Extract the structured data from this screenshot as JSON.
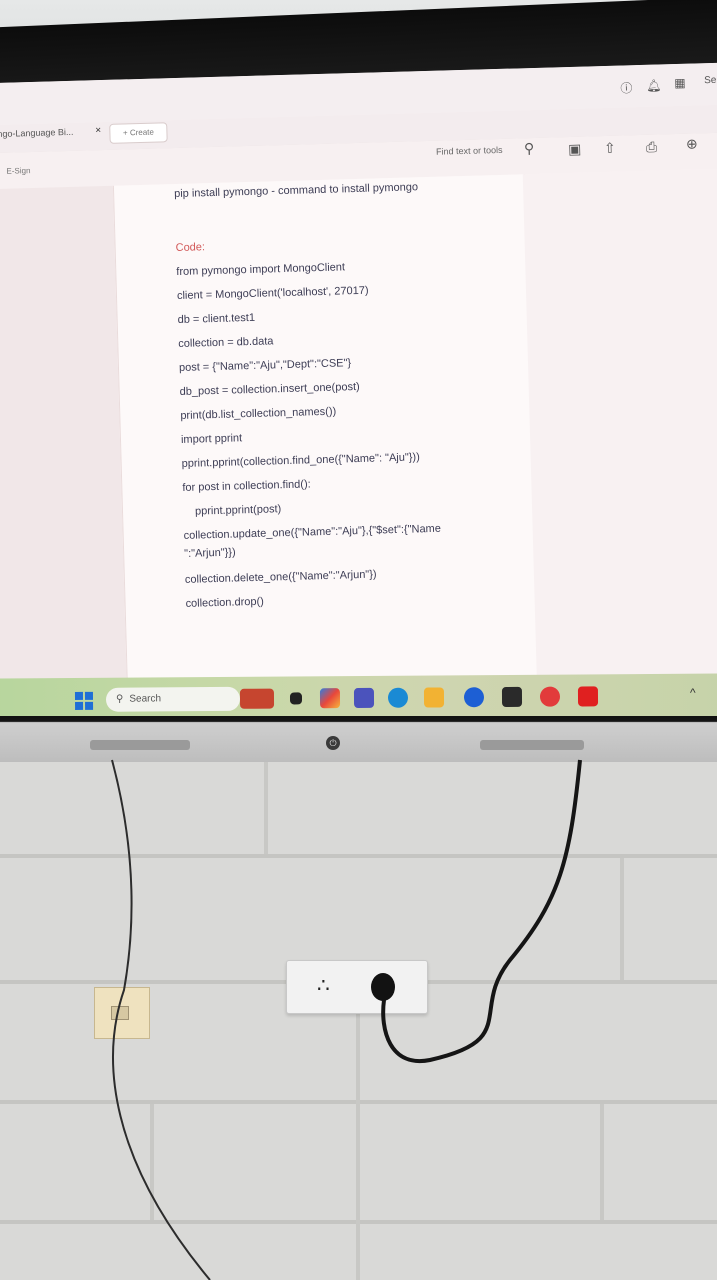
{
  "screen": {
    "tab_label": "ngo-Language Bi...",
    "tab_close": "×",
    "create_button": "+ Create",
    "esign_label": "E-Sign",
    "find_text": "Find text or tools",
    "top_right_label": "Se"
  },
  "document": {
    "lines": [
      "pip install pymongo - command to install pymongo",
      "Code:",
      "from pymongo import MongoClient",
      "client = MongoClient('localhost', 27017)",
      "db = client.test1",
      "collection = db.data",
      "post = {\"Name\":\"Aju\",\"Dept\":\"CSE\"}",
      "db_post = collection.insert_one(post)",
      "print(db.list_collection_names())",
      "import pprint",
      "pprint.pprint(collection.find_one({\"Name\": \"Aju\"}))",
      "for post in collection.find():",
      "pprint.pprint(post)",
      "collection.update_one({\"Name\":\"Aju\"},{\"$set\":{\"Name",
      "\":\"Arjun\"}})",
      "collection.delete_one({\"Name\":\"Arjun\"})",
      "collection.drop()"
    ]
  },
  "taskbar": {
    "search_placeholder": "Search",
    "apps": [
      "windows-start",
      "search",
      "game",
      "file",
      "copilot",
      "teams",
      "edge",
      "file-explorer",
      "app-blue",
      "app-shot",
      "wps",
      "acrobat"
    ],
    "tray_chevron": "^"
  },
  "colors": {
    "code_label": "#d25a5a",
    "doc_text": "#3d3d55",
    "taskbar_accent": "#b7d69d",
    "start_blue": "#1e6fd6"
  }
}
